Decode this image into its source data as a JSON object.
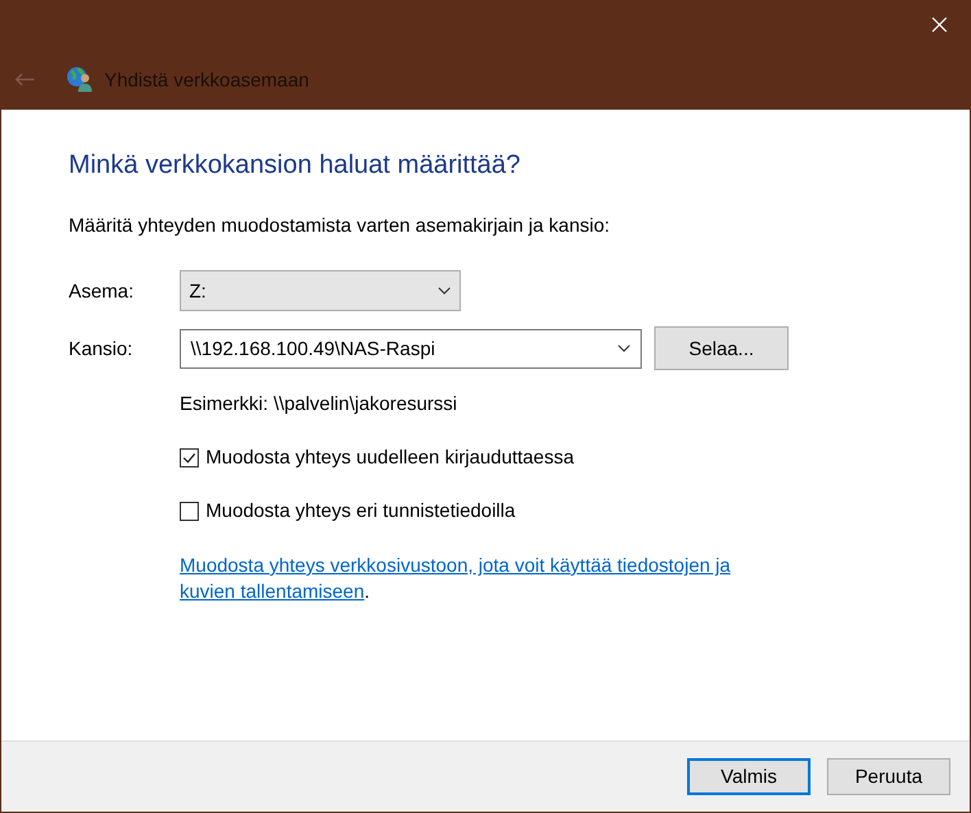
{
  "window": {
    "title": "Yhdistä verkkoasemaan",
    "back_enabled": false
  },
  "heading": "Minkä verkkokansion haluat määrittää?",
  "description": "Määritä yhteyden muodostamista varten asemakirjain ja kansio:",
  "drive": {
    "label": "Asema:",
    "value": "Z:"
  },
  "folder": {
    "label": "Kansio:",
    "value": "\\\\192.168.100.49\\NAS-Raspi",
    "browse": "Selaa..."
  },
  "example": "Esimerkki: \\\\palvelin\\jakoresurssi",
  "options": [
    {
      "label": "Muodosta yhteys uudelleen kirjauduttaessa",
      "checked": true
    },
    {
      "label": "Muodosta yhteys eri tunnistetiedoilla",
      "checked": false
    }
  ],
  "link": {
    "lines": [
      "Muodosta yhteys verkkosivustoon, jota voit käyttää tiedostojen ja",
      "kuvien tallentamiseen"
    ],
    "suffix": "."
  },
  "buttons": [
    {
      "label": "Valmis",
      "selected": true
    },
    {
      "label": "Peruuta",
      "selected": false
    }
  ]
}
